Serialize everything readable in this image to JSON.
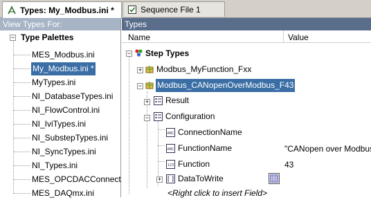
{
  "tabs": [
    {
      "label": "Types: My_Modbus.ini *",
      "icon": "types-file-icon"
    },
    {
      "label": "Sequence File 1",
      "icon": "sequence-file-icon"
    }
  ],
  "left_panel": {
    "header": "View Types For:",
    "root": "Type Palettes",
    "items": [
      "MES_Modbus.ini",
      "My_Modbus.ini *",
      "MyTypes.ini",
      "NI_DatabaseTypes.ini",
      "NI_FlowControl.ini",
      "NI_IviTypes.ini",
      "NI_SubstepTypes.ini",
      "NI_SyncTypes.ini",
      "NI_Types.ini",
      "MES_OPCDACConnect.ini",
      "MES_DAQmx.ini"
    ],
    "selected_index": 1
  },
  "right_panel": {
    "header": "Types",
    "col_name": "Name",
    "col_value": "Value",
    "step_types": "Step Types",
    "fn_fxx": "Modbus_MyFunction_Fxx",
    "fn_f43": "Modbus_CANopenOverModbus_F43",
    "result": "Result",
    "configuration": "Configuration",
    "connection_name": "ConnectionName",
    "function_name": "FunctionName",
    "function_name_value": "\"CANopen over Modbus\"",
    "function": "Function",
    "function_value": "43",
    "data_to_write": "DataToWrite",
    "insert_hint": "<Right click to insert Field>",
    "icon_text_abc": "ABC",
    "icon_num": "123"
  },
  "colors": {
    "selection": "#3a6ea5",
    "types_header": "#5a6e8c",
    "view_header": "#a6b4c6"
  }
}
